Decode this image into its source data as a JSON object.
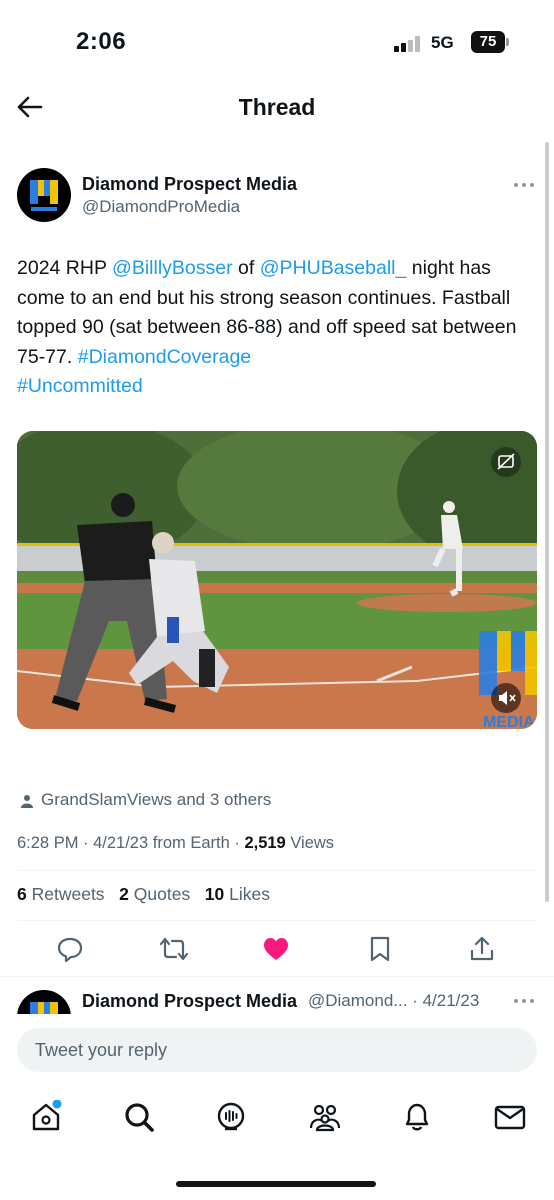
{
  "status_bar": {
    "time": "2:06",
    "network": "5G",
    "battery": "75"
  },
  "header": {
    "title": "Thread"
  },
  "tweet": {
    "author_name": "Diamond Prospect Media",
    "author_handle": "@DiamondProMedia",
    "text": {
      "p1": "2024 RHP ",
      "mention1": "@BilllyBosser",
      "p2": " of ",
      "mention2": "@PHUBaseball_",
      "p3": " night has come to an end but his strong season continues. Fastball topped 90 (sat between 86-88) and off speed sat between 75-77. ",
      "hashtag1": "#DiamondCoverage",
      "hashtag2": "#Uncommitted"
    },
    "media": {
      "watermark": "MEDIA"
    },
    "social_context": "GrandSlamViews and 3 others",
    "meta": {
      "time_date_source": "6:28 PM · 4/21/23 from Earth · ",
      "views_count": "2,519",
      "views_label": " Views"
    },
    "stats": {
      "retweets_count": "6",
      "retweets_label": "Retweets",
      "quotes_count": "2",
      "quotes_label": "Quotes",
      "likes_count": "10",
      "likes_label": "Likes"
    },
    "liked": true,
    "like_color": "#f91880"
  },
  "reply_preview": {
    "author_name": "Diamond Prospect Media",
    "handle_date": "@Diamond... · 4/21/23"
  },
  "compose": {
    "placeholder": "Tweet your reply"
  },
  "tabbar": {
    "items": [
      "home-icon",
      "search-icon",
      "spaces-icon",
      "communities-icon",
      "notifications-icon",
      "messages-icon"
    ],
    "accent": "#1d9bf0"
  }
}
